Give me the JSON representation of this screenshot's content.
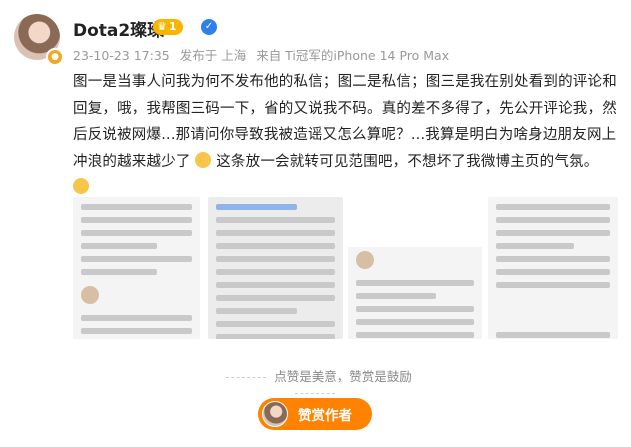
{
  "author": {
    "name": "Dota2璨璨",
    "level": "1",
    "level_icon": "crown-icon",
    "verify_icon": "verified-icon"
  },
  "meta": {
    "timestamp": "23-10-23 17:35",
    "published": "发布于 上海",
    "source": "来自 Ti冠军的iPhone 14 Pro Max"
  },
  "post": {
    "text_part1": "图一是当事人问我为何不发布他的私信；图二是私信；图三是我在别处看到的评论和回复，哦，我帮图三码一下，省的又说我不码。真的差不多得了，先公开评论我，然后反说被网爆...那请问你导致我被造谣又怎么算呢？...我算是明白为啥身边朋友网上冲浪的越来越少了",
    "text_part2": "这条放一会就转可见范围吧，不想坏了我微博主页的气氛。"
  },
  "footer": {
    "like_hint": "点赞是美意，赞赏是鼓励",
    "reward_label": "赞赏作者"
  },
  "colors": {
    "accent": "#ff8200",
    "verify": "#2f80ed",
    "level_badge": "#f7b500"
  }
}
